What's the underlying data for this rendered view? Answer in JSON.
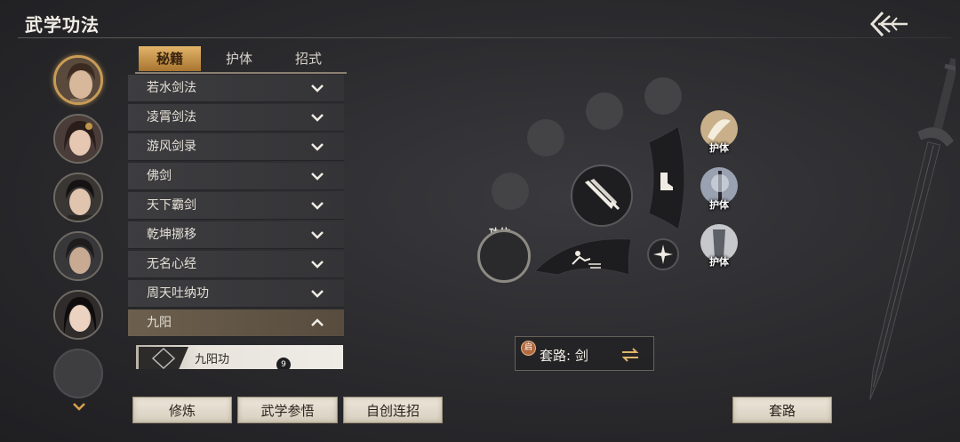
{
  "header": {
    "title": "武学功法",
    "back_icon": "back-arrow-icon"
  },
  "tabs": [
    {
      "label": "秘籍",
      "active": true
    },
    {
      "label": "护体",
      "active": false
    },
    {
      "label": "招式",
      "active": false
    }
  ],
  "list": {
    "items": [
      {
        "label": "若水剑法",
        "expanded": false
      },
      {
        "label": "凌霄剑法",
        "expanded": false
      },
      {
        "label": "游风剑录",
        "expanded": false
      },
      {
        "label": "佛剑",
        "expanded": false
      },
      {
        "label": "天下霸剑",
        "expanded": false
      },
      {
        "label": "乾坤挪移",
        "expanded": false
      },
      {
        "label": "无名心经",
        "expanded": false
      },
      {
        "label": "周天吐纳功",
        "expanded": false
      },
      {
        "label": "九阳",
        "expanded": true
      }
    ],
    "sub_item": {
      "label": "九阳功",
      "badge": "9"
    }
  },
  "buttons": {
    "practice": "修炼",
    "comprehend": "武学参悟",
    "custom_combo": "自创连招",
    "route": "套路"
  },
  "wheel": {
    "gong_label": "功体",
    "hu_items": [
      {
        "label": "护体"
      },
      {
        "label": "护体"
      },
      {
        "label": "护体"
      }
    ]
  },
  "route_box": {
    "badge": "启",
    "label": "套路: 剑"
  },
  "colors": {
    "accent_gold": "#c99b56",
    "tab_active": "#d6a45c"
  }
}
